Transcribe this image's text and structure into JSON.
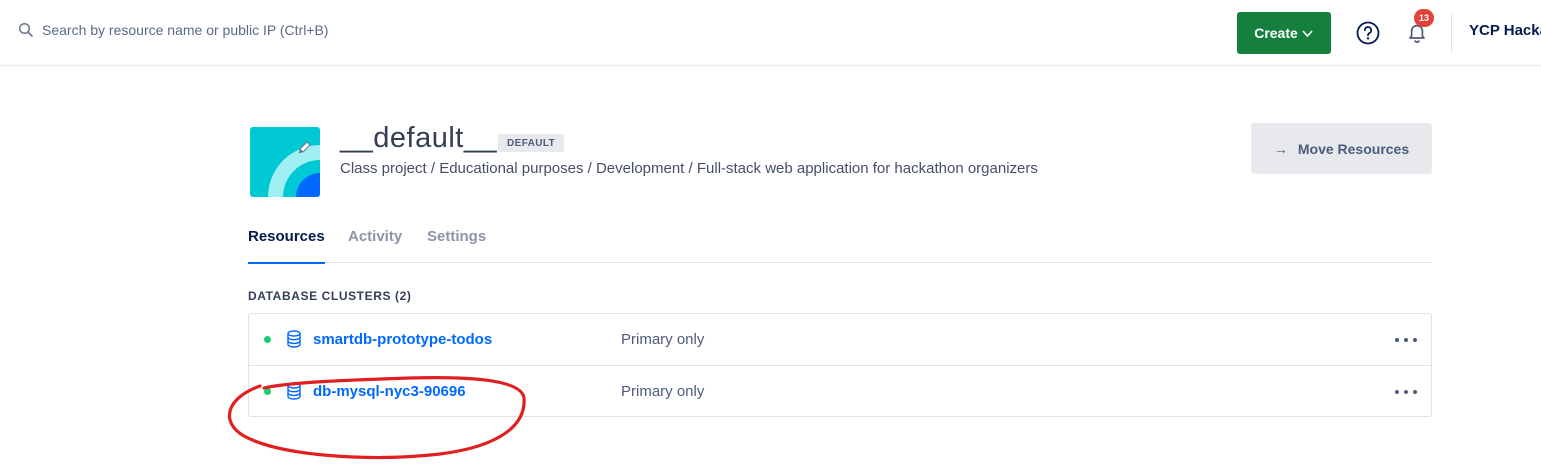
{
  "search": {
    "placeholder": "Search by resource name or public IP (Ctrl+B)"
  },
  "header": {
    "create_label": "Create",
    "notifications_count": "13",
    "team_name": "YCP Hackathon"
  },
  "project": {
    "name": "__default__",
    "badge": "DEFAULT",
    "description": "Class project / Educational purposes / Development / Full-stack web application for hackathon organizers",
    "move_button": "Move Resources",
    "move_arrow": "→"
  },
  "tabs": [
    {
      "label": "Resources",
      "active": true
    },
    {
      "label": "Activity",
      "active": false
    },
    {
      "label": "Settings",
      "active": false
    }
  ],
  "section": {
    "title": "DATABASE CLUSTERS (2)"
  },
  "clusters": [
    {
      "name": "smartdb-prototype-todos",
      "mode": "Primary only",
      "status": "online"
    },
    {
      "name": "db-mysql-nyc3-90696",
      "mode": "Primary only",
      "status": "online"
    }
  ],
  "colors": {
    "accent": "#0069ff",
    "create_green": "#15803d",
    "status_green": "#15cd72",
    "badge_red": "#e5413b",
    "annotation_red": "#e02020"
  }
}
